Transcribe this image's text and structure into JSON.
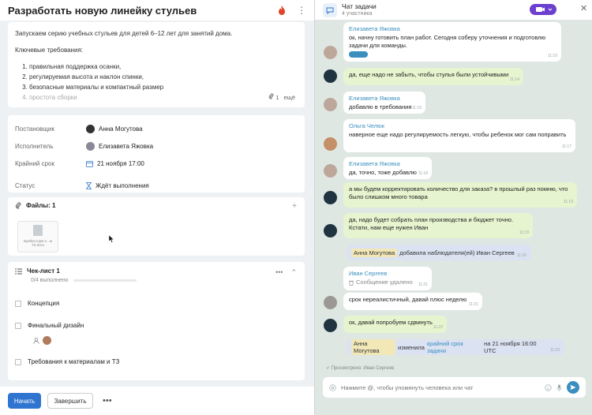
{
  "task": {
    "title": "Разработать новую линейку стульев",
    "description": {
      "intro": "Запускаем серию учебных стульев для детей 6–12 лет для занятий дома.",
      "req_heading": "Ключевые требования:",
      "items": [
        "правильная поддержка осанки,",
        "регулируемая высота и наклон спинки,",
        "безопасные материалы и компактный размер",
        "простота сборки"
      ],
      "attach_count": "1",
      "more_label": "ещё"
    },
    "props": {
      "creator_label": "Постановщик",
      "creator": "Анна Могутова",
      "assignee_label": "Исполнитель",
      "assignee": "Елизавета Яжовка",
      "deadline_label": "Крайний срок",
      "deadline": "21 ноября 17:00",
      "status_label": "Статус",
      "status": "Ждёт выполнения"
    },
    "files": {
      "title": "Файлы: 1",
      "file_name": "Брейнсторм п...м ТЗ.docx"
    },
    "checklist": {
      "title": "Чек-лист 1",
      "progress_text": "0/4 выполнено",
      "progress": 0,
      "items": [
        "Концепция",
        "Финальный дизайн",
        "Требования к материалам и ТЗ"
      ]
    },
    "actions": {
      "start": "Начать",
      "finish": "Завершить",
      "more": "•••"
    }
  },
  "chat": {
    "title": "Чат задачи",
    "subtitle": "4 участника",
    "messages": [
      {
        "sender": "Елизавета Яжовка",
        "text": "ок, начну готовить план работ. Сегодня соберу уточнения и подготовлю задачи для команды.",
        "time": "11:10"
      },
      {
        "text": "да, еще надо не забыть, чтобы стулья были устойчивыми",
        "time": "11:14"
      },
      {
        "sender": "Елизавета Яжовка",
        "text": "добавлю в требования",
        "time": "11:16"
      },
      {
        "sender": "Ольга Челюк",
        "text": "наверное еще надо регулируемость легкую, чтобы ребенок мог сам поправить",
        "time": "11:17"
      },
      {
        "sender": "Елизавета Яжовка",
        "text": "да, точно, тоже добавлю",
        "time": "11:18"
      },
      {
        "text": "а мы будем корректировать количество для заказа? в прошлый раз помню, что было слишком много товара",
        "time": "11:19"
      },
      {
        "text": "да, надо будет собрать план производства и бюджет точно. Кстати, нам еще нужен Иван",
        "time": "11:19"
      },
      {
        "sender": "Иван Сергеев",
        "text": "срок нереалистичный, давай плюс неделю",
        "time": "11:21"
      },
      {
        "text": "ок, давай попробуем сдвинуть",
        "time": "11:22"
      }
    ],
    "sys1": {
      "who": "Анна Могутова",
      "action": "добавила наблюдателя(ей) Иван Сергеев",
      "time": "11:20"
    },
    "deleted": {
      "sender": "Иван Сергеев",
      "text": "Сообщение удалено",
      "time": "11:21"
    },
    "sys2": {
      "who": "Анна Могутова",
      "action": "изменила",
      "link": "крайний срок задачи",
      "rest": "на 21 ноября 16:00 UTC",
      "time": "11:23"
    },
    "viewed": "Просмотрено: Иван Сергеев",
    "composer_placeholder": "Нажмите @, чтобы упомянуть человека или чат"
  },
  "colors": {
    "accent": "#2f74d0",
    "chat_bg": "#dfe7e3",
    "mine_bubble": "#e6f4cf",
    "sender_name": "#3a8fbf",
    "video_button": "#6c3fcf",
    "fire": "#e0452b"
  },
  "icons": {
    "header": [
      "fire-icon",
      "kebab-icon",
      "chat-icon",
      "video-icon",
      "close-icon"
    ],
    "composer": [
      "emoji-icon",
      "mic-icon",
      "send-icon"
    ]
  }
}
